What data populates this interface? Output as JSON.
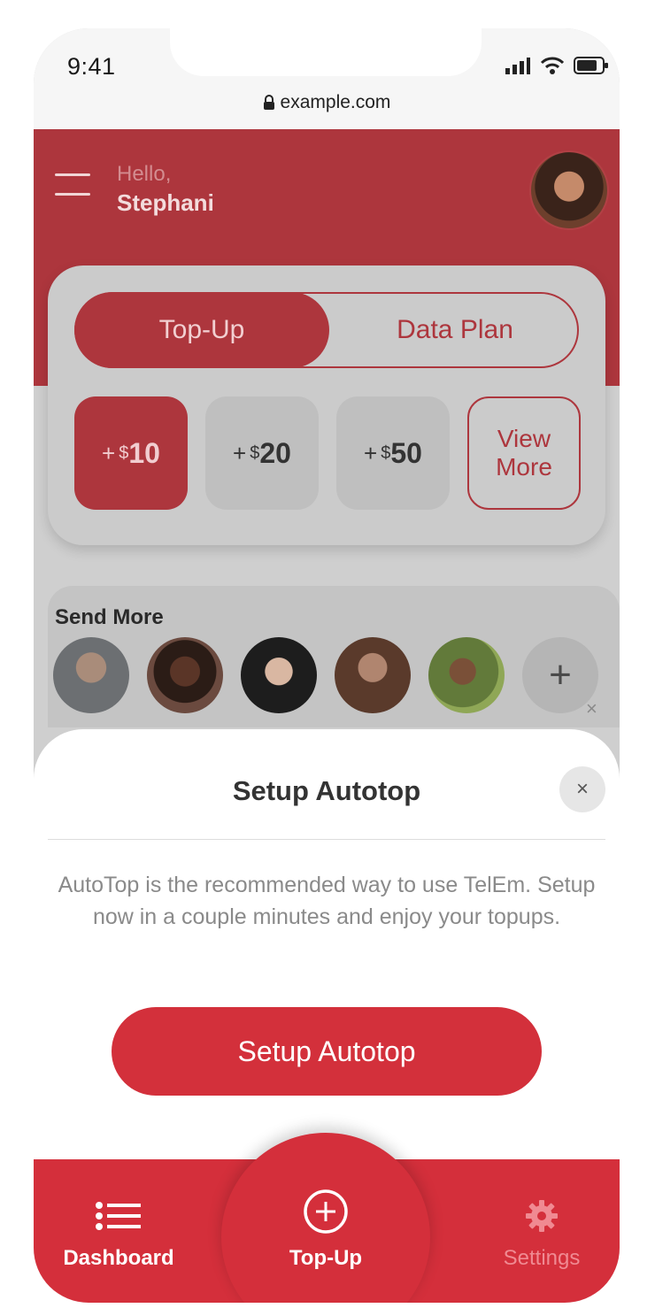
{
  "status": {
    "time": "9:41",
    "url": "example.com"
  },
  "header": {
    "greeting": "Hello,",
    "name": "Stephani"
  },
  "segment": {
    "active": "Top-Up",
    "inactive": "Data Plan"
  },
  "amounts": [
    {
      "plus": "+",
      "currency": "$",
      "value": "10"
    },
    {
      "plus": "+",
      "currency": "$",
      "value": "20"
    },
    {
      "plus": "+",
      "currency": "$",
      "value": "50"
    }
  ],
  "view_more": {
    "line1": "View",
    "line2": "More"
  },
  "send_more": {
    "title": "Send More",
    "add_symbol": "+"
  },
  "sheet": {
    "title": "Setup Autotop",
    "close_symbol": "×",
    "description": "AutoTop is the recommended way to use TelEm. Setup now in a couple minutes and enjoy your topups.",
    "cta": "Setup Autotop"
  },
  "tabs": {
    "dashboard": "Dashboard",
    "topup": "Top-Up",
    "settings": "Settings"
  },
  "colors": {
    "brand_red": "#d42f3b",
    "header_red": "#ad363d"
  },
  "icons": [
    "lock-icon",
    "signal-icon",
    "wifi-icon",
    "battery-icon",
    "menu-icon",
    "list-icon",
    "plus-circle-icon",
    "gear-icon",
    "close-icon",
    "add-icon"
  ]
}
